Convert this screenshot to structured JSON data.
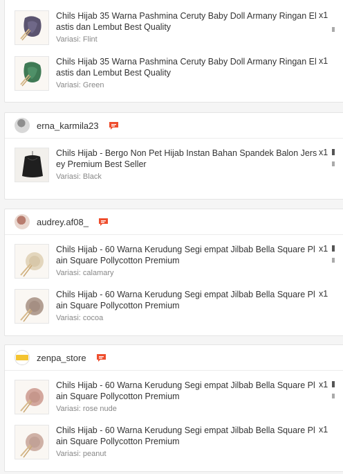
{
  "orders": [
    {
      "shop": null,
      "items": [
        {
          "title": "Chils Hijab 35 Warna Pashmina Ceruty Baby Doll Armany Ringan Elastis dan Lembut Best Quality",
          "qty": "x1",
          "variant": "Variasi: Flint",
          "color": "#5b5470"
        },
        {
          "title": "Chils Hijab 35 Warna Pashmina Ceruty Baby Doll Armany Ringan Elastis dan Lembut Best Quality",
          "qty": "x1",
          "variant": "Variasi: Green",
          "color": "#3f7a55"
        }
      ]
    },
    {
      "shop": "erna_karmila23",
      "items": [
        {
          "title": "Chils Hijab - Bergo Non Pet Hijab Instan Bahan Spandek Balon Jersey Premium Best Seller",
          "qty": "x1",
          "variant": "Variasi: Black",
          "color": "#1f1f1f"
        }
      ]
    },
    {
      "shop": "audrey.af08_",
      "items": [
        {
          "title": "Chils Hijab - 60 Warna Kerudung Segi empat Jilbab Bella Square Plain Square Pollycotton Premium",
          "qty": "x1",
          "variant": "Variasi: calamary",
          "color": "#e3d6bd"
        },
        {
          "title": "Chils Hijab - 60 Warna Kerudung Segi empat Jilbab Bella Square Plain Square Pollycotton Premium",
          "qty": "x1",
          "variant": "Variasi: cocoa",
          "color": "#b39f93"
        }
      ]
    },
    {
      "shop": "zenpa_store",
      "items": [
        {
          "title": "Chils Hijab - 60 Warna Kerudung Segi empat Jilbab Bella Square Plain Square Pollycotton Premium",
          "qty": "x1",
          "variant": "Variasi: rose nude",
          "color": "#d3a79d"
        },
        {
          "title": "Chils Hijab - 60 Warna Kerudung Segi empat Jilbab Bella Square Plain Square Pollycotton Premium",
          "qty": "x1",
          "variant": "Variasi: peanut",
          "color": "#cfb1a6"
        }
      ]
    }
  ],
  "icons": {
    "chat": "chat-icon"
  },
  "colors": {
    "chat_accent": "#ee4d2d",
    "variant_text": "#888888"
  }
}
